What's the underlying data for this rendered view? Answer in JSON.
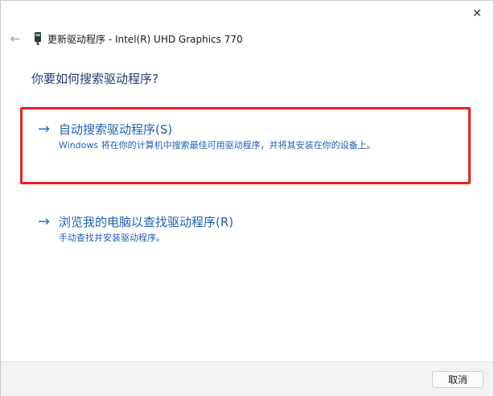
{
  "window": {
    "title": "更新驱动程序 - Intel(R) UHD Graphics 770",
    "close_glyph": "✕",
    "back_glyph": "←",
    "device_icon": "graphics-card-icon"
  },
  "main": {
    "question": "你要如何搜索驱动程序?",
    "options": [
      {
        "label": "自动搜索驱动程序(S)",
        "description": "Windows 将在你的计算机中搜索最佳可用驱动程序，并将其安装在你的设备上。",
        "highlighted": true
      },
      {
        "label": "浏览我的电脑以查找驱动程序(R)",
        "description": "手动查找并安装驱动程序。",
        "highlighted": false
      }
    ],
    "arrow_glyph": "→"
  },
  "footer": {
    "cancel_label": "取消"
  },
  "colors": {
    "accent": "#1f5fb4",
    "highlight_border": "#e8231d",
    "footer_bg": "#f3f3f3"
  }
}
